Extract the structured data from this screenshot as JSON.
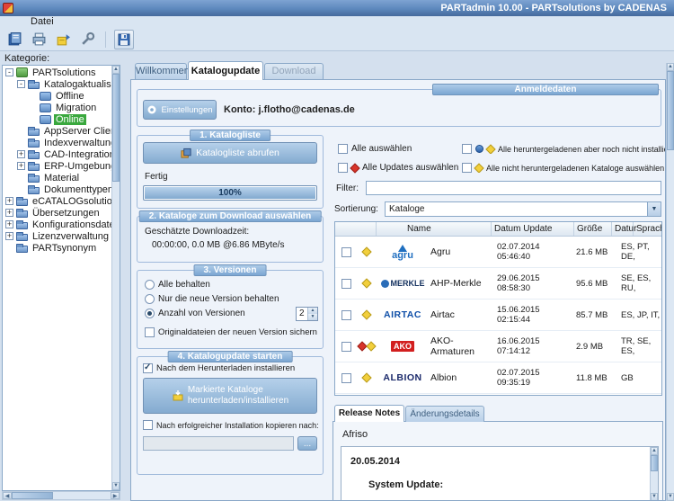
{
  "window": {
    "title": "PARTadmin 10.00 - PARTsolutions by CADENAS"
  },
  "menu": {
    "items": [
      {
        "label": "Datei"
      }
    ]
  },
  "toolbar": {
    "icons": [
      "catalog-book-icon",
      "printer-icon",
      "package-install-icon",
      "tools-icon",
      "save-icon"
    ]
  },
  "sidebar": {
    "label": "Kategorie:",
    "tree": [
      {
        "label": "PARTsolutions",
        "level": 0,
        "expander": "-",
        "icon": "root"
      },
      {
        "label": "Katalogaktualisierung",
        "level": 1,
        "expander": "-",
        "icon": "folder"
      },
      {
        "label": "Offline",
        "level": 2,
        "expander": "",
        "icon": "offline"
      },
      {
        "label": "Migration",
        "level": 2,
        "expander": "",
        "icon": "migration"
      },
      {
        "label": "Online",
        "level": 2,
        "expander": "",
        "icon": "online",
        "selected": true
      },
      {
        "label": "AppServer Client",
        "level": 1,
        "expander": "",
        "icon": "folder"
      },
      {
        "label": "Indexverwaltung",
        "level": 1,
        "expander": "",
        "icon": "folder"
      },
      {
        "label": "CAD-Integration",
        "level": 1,
        "expander": "+",
        "icon": "folder"
      },
      {
        "label": "ERP-Umgebung",
        "level": 1,
        "expander": "+",
        "icon": "folder"
      },
      {
        "label": "Material",
        "level": 1,
        "expander": "",
        "icon": "folder"
      },
      {
        "label": "Dokumenttypen",
        "level": 1,
        "expander": "",
        "icon": "folder"
      },
      {
        "label": "eCATALOGsolutions",
        "level": 0,
        "expander": "+",
        "icon": "folder"
      },
      {
        "label": "Übersetzungen",
        "level": 0,
        "expander": "+",
        "icon": "folder"
      },
      {
        "label": "Konfigurationsdateien",
        "level": 0,
        "expander": "+",
        "icon": "folder"
      },
      {
        "label": "Lizenzverwaltung",
        "level": 0,
        "expander": "+",
        "icon": "folder"
      },
      {
        "label": "PARTsynonym",
        "level": 0,
        "expander": "",
        "icon": "folder"
      }
    ]
  },
  "tabs": {
    "willkommen": "Willkommen",
    "katalogupdate": "Katalogupdate",
    "download": "Download"
  },
  "login": {
    "group_label": "Anmeldedaten",
    "settings_button": "Einstellungen",
    "account": "Konto: j.flotho@cadenas.de"
  },
  "step1": {
    "group_label": "1. Katalogliste",
    "fetch_button": "Katalogliste abrufen",
    "status": "Fertig",
    "progress": "100%"
  },
  "step2": {
    "group_label": "2. Kataloge zum Download auswählen",
    "label": "Geschätzte Downloadzeit:",
    "value": "00:00:00, 0.0 MB  @6.86 MByte/s"
  },
  "step3": {
    "group_label": "3. Versionen",
    "radio_keep_all": "Alle behalten",
    "radio_keep_new": "Nur die neue Version behalten",
    "radio_count": "Anzahl von Versionen",
    "count_value": "2",
    "backup": "Originaldateien der neuen Version sichern"
  },
  "step4": {
    "group_label": "4. Katalogupdate starten",
    "install_after": "Nach dem Herunterladen installieren",
    "start_button_line1": "Markierte Kataloge",
    "start_button_line2": "herunterladen/installieren",
    "copy_after": "Nach erfolgreicher Installation kopieren nach:",
    "copy_path": "",
    "browse_button": "..."
  },
  "selection": {
    "select_all": "Alle auswählen",
    "select_updates": "Alle Updates auswählen",
    "select_downloaded": "Alle heruntergeladenen aber noch nicht installierten Kataloge auswählen",
    "select_not_downloaded": "Alle nicht heruntergeladenen Kataloge auswählen",
    "filter_label": "Filter:",
    "filter_value": "",
    "sort_label": "Sortierung:",
    "sort_value": "Kataloge"
  },
  "catalog_table": {
    "columns": {
      "name": "Name",
      "date": "Datum Update",
      "size": "Größe",
      "col4": "Datur",
      "language": "Sprache"
    },
    "rows": [
      {
        "logo": "agru",
        "logo_text": "agru",
        "name": "Agru",
        "date": "02.07.2014 05:46:40",
        "size": "21.6 MB",
        "languages": "ES, PT, DE,",
        "icons": [
          "yellow"
        ]
      },
      {
        "logo": "merkle",
        "logo_text": "MERKLE",
        "name": "AHP-Merkle",
        "date": "29.06.2015 08:58:30",
        "size": "95.6 MB",
        "languages": "SE, ES, RU,",
        "icons": [
          "yellow"
        ]
      },
      {
        "logo": "airtac",
        "logo_text": "AIRTAC",
        "name": "Airtac",
        "date": "15.06.2015 02:15:44",
        "size": "85.7 MB",
        "languages": "ES, JP, IT,",
        "icons": [
          "yellow"
        ]
      },
      {
        "logo": "ako",
        "logo_text": "AKO",
        "name": "AKO-Armaturen",
        "date": "16.06.2015 07:14:12",
        "size": "2.9 MB",
        "languages": "TR, SE, ES,",
        "icons": [
          "red",
          "yellow"
        ]
      },
      {
        "logo": "albion",
        "logo_text": "ALBION",
        "name": "Albion",
        "date": "02.07.2015 09:35:19",
        "size": "11.8 MB",
        "languages": "GB",
        "icons": [
          "yellow"
        ]
      }
    ]
  },
  "notes": {
    "tab_release": "Release Notes",
    "tab_changes": "Änderungsdetails",
    "catalog": "Afriso",
    "date": "20.05.2014",
    "entry": "System Update:"
  },
  "colors": {
    "accent": "#4a79b0",
    "selected_green": "#3aa83e",
    "titlebar": "#5d88bd"
  }
}
